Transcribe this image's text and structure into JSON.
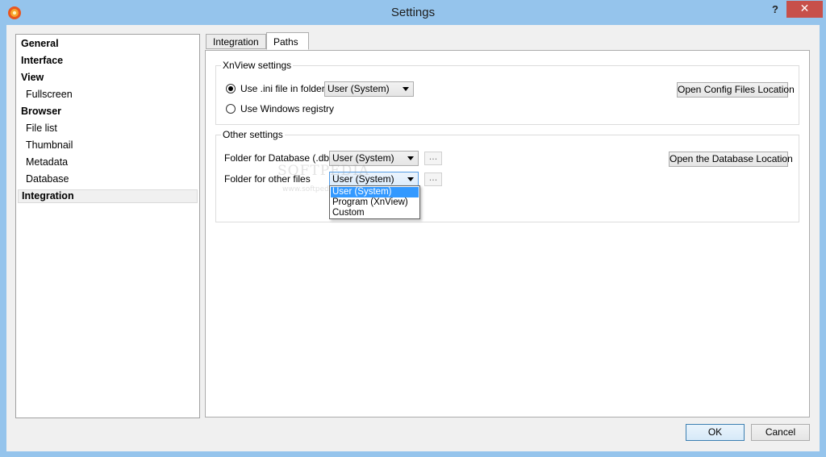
{
  "window": {
    "title": "Settings",
    "help_label": "?",
    "close_label": "✕",
    "accent": "#95c4ec",
    "close_color": "#c7504a"
  },
  "sidebar": {
    "items": [
      {
        "label": "General",
        "bold": true
      },
      {
        "label": "Interface",
        "bold": true
      },
      {
        "label": "View",
        "bold": true
      },
      {
        "label": "Fullscreen",
        "bold": false
      },
      {
        "label": "Browser",
        "bold": true
      },
      {
        "label": "File list",
        "bold": false
      },
      {
        "label": "Thumbnail",
        "bold": false
      },
      {
        "label": "Metadata",
        "bold": false
      },
      {
        "label": "Database",
        "bold": false
      },
      {
        "label": "Integration",
        "bold": true,
        "selected": true
      }
    ]
  },
  "tabs": [
    {
      "label": "Integration",
      "active": false
    },
    {
      "label": "Paths",
      "active": true
    }
  ],
  "xnview_settings": {
    "title": "XnView settings",
    "ini_option": {
      "label": "Use .ini file in folder",
      "checked": true
    },
    "ini_combo_value": "User (System)",
    "registry_option": {
      "label": "Use Windows registry",
      "checked": false
    },
    "open_config_button": "Open Config Files Location"
  },
  "other_settings": {
    "title": "Other settings",
    "database_label": "Folder for Database (.db)",
    "database_combo_value": "User (System)",
    "database_browse": "...",
    "open_database_button": "Open the Database Location",
    "other_files_label": "Folder for other files",
    "other_files_combo_value": "User (System)",
    "other_files_browse": "..."
  },
  "dropdown": {
    "options": [
      "User (System)",
      "Program (XnView)",
      "Custom"
    ],
    "selected_index": 0,
    "highlight": "#3399ff"
  },
  "watermark": {
    "text": "SOFTPEDIA",
    "subtext": "www.softpedia.com"
  },
  "footer": {
    "ok_label": "OK",
    "cancel_label": "Cancel"
  }
}
